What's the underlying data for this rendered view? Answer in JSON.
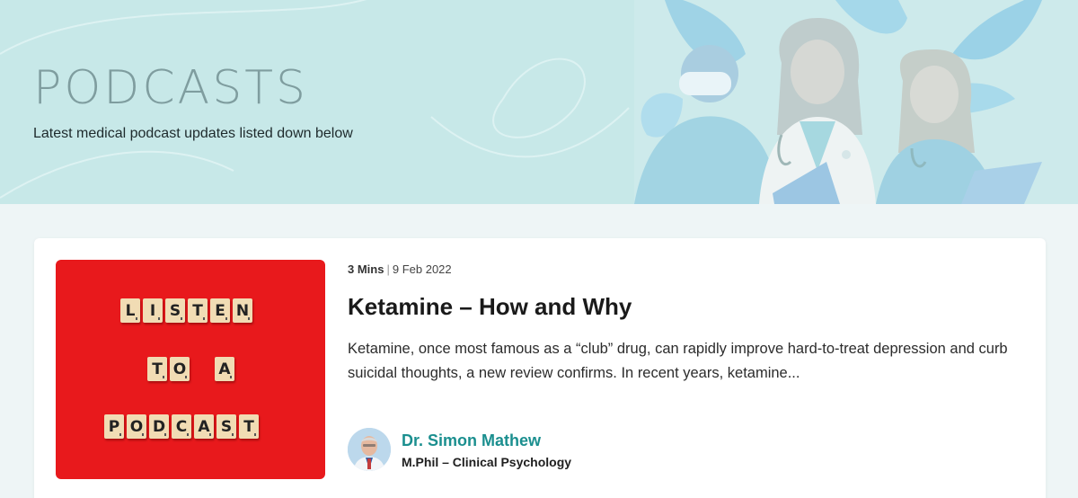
{
  "hero": {
    "title": "PODCASTS",
    "subtitle": "Latest medical podcast updates listed down below"
  },
  "podcast": {
    "thumbnail_rows": [
      [
        "L",
        "I",
        "S",
        "T",
        "E",
        "N"
      ],
      [
        "T",
        "O",
        "A"
      ],
      [
        "P",
        "O",
        "D",
        "C",
        "A",
        "S",
        "T"
      ]
    ],
    "duration": "3 Mins",
    "separator": "|",
    "date": "9 Feb 2022",
    "title": "Ketamine – How and Why",
    "excerpt": "Ketamine, once most famous as a “club” drug, can rapidly improve hard-to-treat depression and curb suicidal thoughts, a new review confirms. In recent years, ketamine...",
    "author": {
      "name": "Dr. Simon Mathew",
      "role": "M.Phil – Clinical Psychology"
    }
  },
  "colors": {
    "hero_bg": "#c7e8e8",
    "thumbnail_bg": "#e8191c",
    "author_accent": "#1b8f8f"
  },
  "icons": {
    "hero_illustration": "medical-staff-illustration",
    "avatar": "doctor-avatar"
  }
}
